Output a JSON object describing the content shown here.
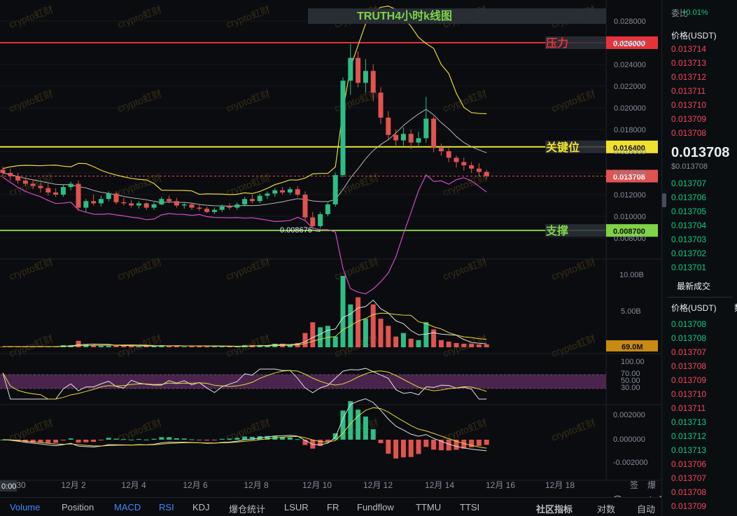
{
  "chart_data": {
    "type": "candlestick",
    "title": "TRUTH4小时k线图",
    "y_range": [
      0.0078,
      0.0292
    ],
    "y_ticks": [
      "0.028000",
      "0.026000",
      "0.024000",
      "0.022000",
      "0.020000",
      "0.018000",
      "0.016000",
      "0.014000",
      "0.012000",
      "0.010000",
      "0.008000"
    ],
    "x_ticks": [
      "30",
      "12月 2",
      "12月 4",
      "12月 6",
      "12月 8",
      "12月 10",
      "12月 12",
      "12月 14",
      "12月 16",
      "12月 18"
    ],
    "x_axis_first_label": "0:00",
    "price_levels": [
      {
        "label": "压力",
        "value": "0.026000",
        "price": 0.026,
        "color": "#e5333b"
      },
      {
        "label": "关键位",
        "value": "0.016400",
        "price": 0.0164,
        "color": "#f0e130"
      },
      {
        "label": "支撑",
        "value": "0.008700",
        "price": 0.0087,
        "color": "#7ed348"
      }
    ],
    "current_price": {
      "value": "0.013708",
      "price": 0.013708
    },
    "low_annotation": "0.008676",
    "candles": [
      [
        0.0143,
        0.0146,
        0.0136,
        0.014
      ],
      [
        0.014,
        0.0144,
        0.0133,
        0.0137
      ],
      [
        0.0137,
        0.014,
        0.013,
        0.0133
      ],
      [
        0.0133,
        0.0136,
        0.0128,
        0.013
      ],
      [
        0.013,
        0.0134,
        0.0125,
        0.0128
      ],
      [
        0.0128,
        0.0131,
        0.0122,
        0.0126
      ],
      [
        0.0126,
        0.013,
        0.0119,
        0.0122
      ],
      [
        0.0122,
        0.0126,
        0.0118,
        0.012
      ],
      [
        0.012,
        0.0129,
        0.0118,
        0.0127
      ],
      [
        0.0127,
        0.0132,
        0.0124,
        0.013
      ],
      [
        0.013,
        0.0133,
        0.0105,
        0.0108
      ],
      [
        0.0108,
        0.0116,
        0.0104,
        0.0114
      ],
      [
        0.0114,
        0.012,
        0.011,
        0.0112
      ],
      [
        0.0112,
        0.0119,
        0.0109,
        0.0116
      ],
      [
        0.0116,
        0.0123,
        0.0114,
        0.0121
      ],
      [
        0.0121,
        0.0123,
        0.0111,
        0.0113
      ],
      [
        0.0113,
        0.0117,
        0.011,
        0.0112
      ],
      [
        0.0112,
        0.0115,
        0.0108,
        0.011
      ],
      [
        0.011,
        0.0114,
        0.0107,
        0.0112
      ],
      [
        0.0112,
        0.0113,
        0.0106,
        0.0108
      ],
      [
        0.0108,
        0.0113,
        0.0106,
        0.0111
      ],
      [
        0.0111,
        0.0118,
        0.011,
        0.0116
      ],
      [
        0.0116,
        0.0119,
        0.0112,
        0.0114
      ],
      [
        0.0114,
        0.0117,
        0.0108,
        0.011
      ],
      [
        0.011,
        0.0113,
        0.0107,
        0.0111
      ],
      [
        0.0111,
        0.0112,
        0.0106,
        0.0108
      ],
      [
        0.0108,
        0.0111,
        0.0105,
        0.0107
      ],
      [
        0.0107,
        0.0109,
        0.0103,
        0.0104
      ],
      [
        0.0104,
        0.0108,
        0.0102,
        0.0106
      ],
      [
        0.0106,
        0.0111,
        0.0104,
        0.0109
      ],
      [
        0.0109,
        0.0112,
        0.0106,
        0.0108
      ],
      [
        0.0108,
        0.0113,
        0.0106,
        0.0111
      ],
      [
        0.0111,
        0.0118,
        0.0109,
        0.0116
      ],
      [
        0.0116,
        0.012,
        0.0112,
        0.0114
      ],
      [
        0.0114,
        0.0121,
        0.0112,
        0.0119
      ],
      [
        0.0119,
        0.0123,
        0.0116,
        0.0121
      ],
      [
        0.0121,
        0.0126,
        0.0118,
        0.0124
      ],
      [
        0.0124,
        0.0127,
        0.012,
        0.0122
      ],
      [
        0.0122,
        0.0127,
        0.012,
        0.0125
      ],
      [
        0.0125,
        0.0128,
        0.0118,
        0.012
      ],
      [
        0.012,
        0.0123,
        0.0096,
        0.0099
      ],
      [
        0.0099,
        0.0104,
        0.0087,
        0.0091
      ],
      [
        0.0091,
        0.0104,
        0.0089,
        0.0102
      ],
      [
        0.0102,
        0.0113,
        0.01,
        0.0111
      ],
      [
        0.0111,
        0.014,
        0.0109,
        0.0138
      ],
      [
        0.0138,
        0.0228,
        0.0136,
        0.0225
      ],
      [
        0.0225,
        0.0259,
        0.0212,
        0.0246
      ],
      [
        0.0246,
        0.0252,
        0.0219,
        0.0223
      ],
      [
        0.0223,
        0.0245,
        0.0214,
        0.0234
      ],
      [
        0.0234,
        0.024,
        0.0206,
        0.0214
      ],
      [
        0.0214,
        0.0219,
        0.0185,
        0.0191
      ],
      [
        0.0191,
        0.0197,
        0.017,
        0.0175
      ],
      [
        0.0175,
        0.018,
        0.0164,
        0.017
      ],
      [
        0.017,
        0.0182,
        0.0165,
        0.0176
      ],
      [
        0.0176,
        0.018,
        0.0162,
        0.0168
      ],
      [
        0.0168,
        0.0178,
        0.0165,
        0.0172
      ],
      [
        0.0172,
        0.021,
        0.0168,
        0.019
      ],
      [
        0.019,
        0.0192,
        0.0159,
        0.0163
      ],
      [
        0.0163,
        0.0167,
        0.0156,
        0.016
      ],
      [
        0.016,
        0.0163,
        0.015,
        0.0154
      ],
      [
        0.0154,
        0.0156,
        0.0145,
        0.015
      ],
      [
        0.015,
        0.0154,
        0.0142,
        0.0147
      ],
      [
        0.0147,
        0.015,
        0.014,
        0.0144
      ],
      [
        0.0144,
        0.0149,
        0.0137,
        0.0141
      ],
      [
        0.0141,
        0.0143,
        0.0134,
        0.0137
      ]
    ],
    "volume_panel": {
      "ticks": [
        "10.00B",
        "5.00B"
      ],
      "last_value": "69.0M",
      "label_color": "#c88a12"
    },
    "rsi_panel": {
      "ticks": [
        "100.00",
        "70.00",
        "50.00",
        "30.00"
      ]
    },
    "macd_panel": {
      "ticks": [
        "0.002000",
        "0.000000",
        "-0.002000"
      ]
    },
    "watermark": "crypto虹财",
    "corner_watermark": "@ crypto虹财"
  },
  "indicator_tabs": [
    "Volume",
    "Position",
    "MACD",
    "RSI",
    "KDJ",
    "爆仓统计",
    "LSUR",
    "FR",
    "Fundflow",
    "TTMU",
    "TTSI"
  ],
  "active_tabs": [
    "Volume",
    "MACD",
    "RSI"
  ],
  "community_indicators": "社区指标",
  "compare_label": "对数",
  "auto_label": "自动",
  "top_right_chars": [
    "签",
    "爆"
  ],
  "orderbook": {
    "top_label": "委比",
    "top_value": "+0.01%",
    "price_header": "价格(USDT)",
    "asks": [
      "0.013714",
      "0.013713",
      "0.013712",
      "0.013711",
      "0.013710",
      "0.013709",
      "0.013708"
    ],
    "mid_price": "0.013708",
    "mid_price_sub": "$0.013708",
    "bids": [
      "0.013707",
      "0.013706",
      "0.013705",
      "0.013704",
      "0.013703",
      "0.013702",
      "0.013701"
    ],
    "trades_title": "最新成交",
    "trades_header": "价格(USDT)",
    "trades_header_extra": "数",
    "trades": [
      {
        "p": "0.013708",
        "c": "green"
      },
      {
        "p": "0.013708",
        "c": "green"
      },
      {
        "p": "0.013707",
        "c": "red"
      },
      {
        "p": "0.013708",
        "c": "red"
      },
      {
        "p": "0.013709",
        "c": "red"
      },
      {
        "p": "0.013710",
        "c": "red"
      },
      {
        "p": "0.013711",
        "c": "red"
      },
      {
        "p": "0.013713",
        "c": "green"
      },
      {
        "p": "0.013712",
        "c": "green"
      },
      {
        "p": "0.013713",
        "c": "green"
      },
      {
        "p": "0.013706",
        "c": "red"
      },
      {
        "p": "0.013707",
        "c": "red"
      },
      {
        "p": "0.013708",
        "c": "red"
      },
      {
        "p": "0.013709",
        "c": "red"
      }
    ]
  }
}
